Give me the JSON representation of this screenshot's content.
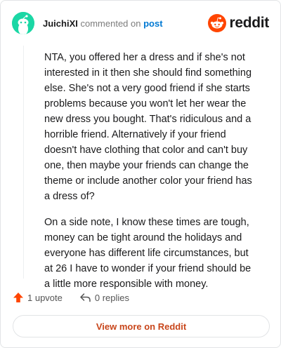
{
  "header": {
    "author": "JuichiXI",
    "commented_text": "commented on",
    "post_link": "post",
    "brand": "reddit"
  },
  "comment": {
    "paragraphs": [
      "NTA, you offered her a dress and if she's not interested in it then she should find something else. She's not a very good friend if she starts problems because you won't let her wear the new dress you bought. That's ridiculous and a horrible friend. Alternatively if your friend doesn't have clothing that color and can't buy one, then maybe your friends can change the theme or include another color your friend has a dress of?",
      "On a side note, I know these times are tough, money can be tight around the holidays and everyone has different life circumstances, but at 26 I have to wonder if your friend should be a little more responsible with money."
    ]
  },
  "actions": {
    "upvote_label": "1 upvote",
    "replies_label": "0 replies"
  },
  "footer": {
    "view_more_label": "View more on Reddit"
  },
  "colors": {
    "avatar": "#1bd7a5",
    "reddit_orange": "#ff4500",
    "link_blue": "#0079d3",
    "view_more": "#c8461b"
  }
}
